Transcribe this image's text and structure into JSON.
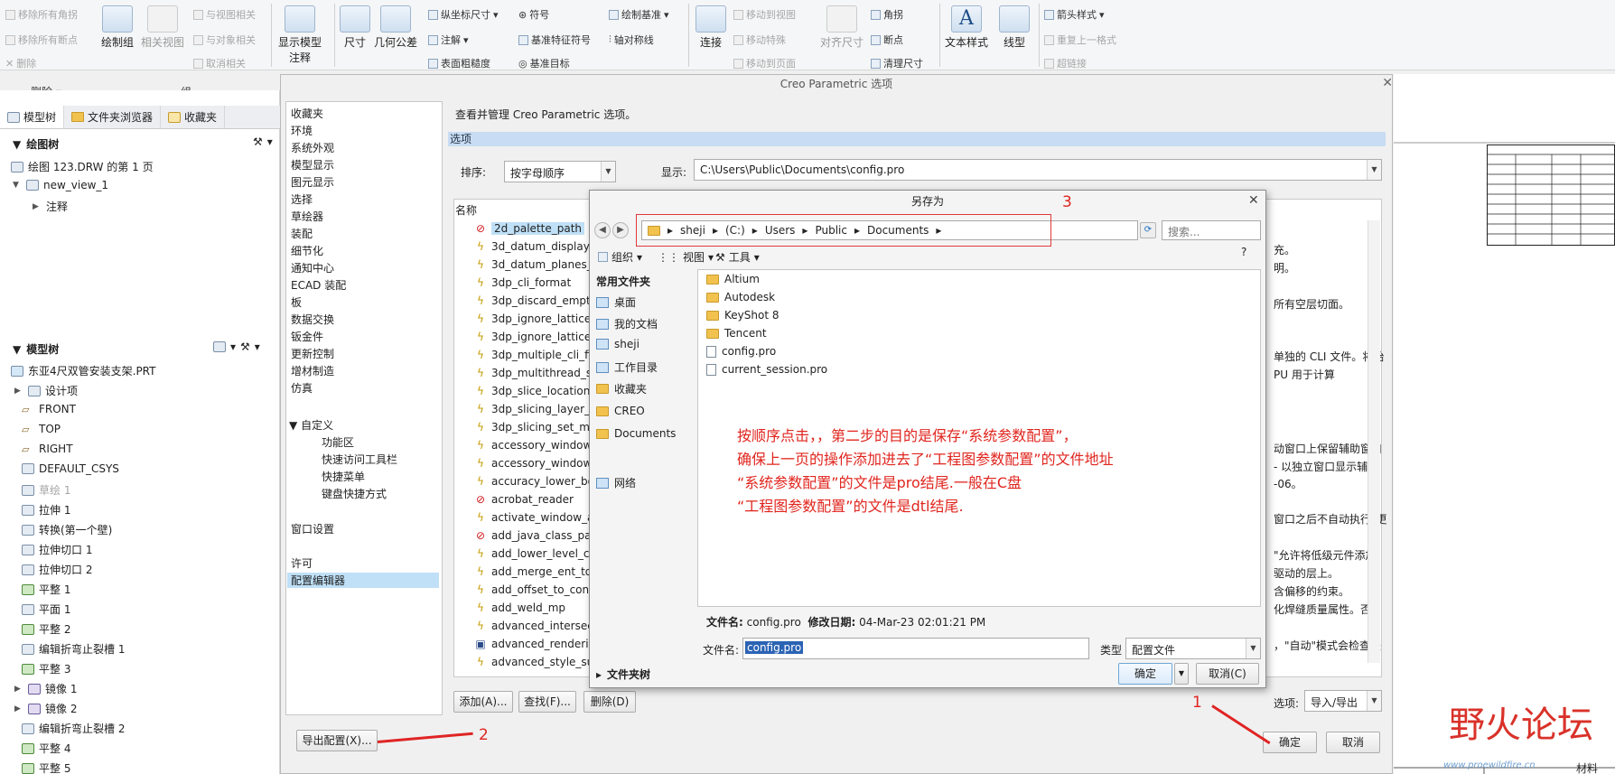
{
  "ribbon": {
    "remove_all_corners": "移除所有角拐",
    "remove_all_breaks": "移除所有断点",
    "delete": "删除",
    "delete_group": "删除",
    "drawing_group": "绘制组",
    "related_view": "相关视图",
    "group_label": "组",
    "with_view_related": "与视图相关",
    "with_object_related": "与对象相关",
    "cancel_related": "取消相关",
    "show_model_annotation": "显示模型",
    "show_model_annotation_2": "注释",
    "dimension": "尺寸",
    "geo_tol": "几何公差",
    "ordinate_dim": "纵坐标尺寸",
    "annotation": "注解",
    "surface_finish": "表面粗糙度",
    "symbol": "符号",
    "datum_feature_symbol": "基准特征符号",
    "datum_target": "基准目标",
    "draw_datum": "绘制基准",
    "axis_symmetry": "轴对称线",
    "connect": "连接",
    "move_to_view": "移动到视图",
    "move_special": "移动特殊",
    "move_to_page": "移动到页面",
    "align_dim": "对齐尺寸",
    "corner": "角拐",
    "break": "断点",
    "cleanup_dim": "清理尺寸",
    "text_style": "文本样式",
    "line_style": "线型",
    "arrow_style": "箭头样式",
    "repeat_format": "重复上一格式",
    "hyperlink": "超链接"
  },
  "left_panel": {
    "tabs": [
      "模型树",
      "文件夹浏览器",
      "收藏夹"
    ],
    "drawing_tree_title": "绘图树",
    "drawing_items": [
      "绘图 123.DRW 的第 1 页",
      "new_view_1",
      "注释"
    ],
    "model_tree_title": "模型树",
    "model_root": "东亚4尺双管安装支架.PRT",
    "model_items": [
      "设计项",
      "FRONT",
      "TOP",
      "RIGHT",
      "DEFAULT_CSYS",
      "草绘 1",
      "拉伸 1",
      "转换(第一个壁)",
      "拉伸切口 1",
      "拉伸切口 2",
      "平整 1",
      "平面 1",
      "平整 2",
      "编辑折弯止裂槽 1",
      "平整 3",
      "镜像 1",
      "镜像 2",
      "编辑折弯止裂槽 2",
      "平整 4",
      "平整 5"
    ]
  },
  "options_dialog": {
    "title": "Creo Parametric 选项",
    "categories": [
      "收藏夹",
      "环境",
      "系统外观",
      "模型显示",
      "图元显示",
      "选择",
      "草绘器",
      "装配",
      "细节化",
      "通知中心",
      "ECAD 装配",
      "板",
      "数据交换",
      "钣金件",
      "更新控制",
      "增材制造",
      "仿真"
    ],
    "custom": "自定义",
    "custom_sub": [
      "功能区",
      "快速访问工具栏",
      "快捷菜单",
      "键盘快捷方式"
    ],
    "window_settings": "窗口设置",
    "license": "许可",
    "config_editor": "配置编辑器",
    "description": "查看并管理 Creo Parametric 选项。",
    "section": "选项",
    "sort_label": "排序:",
    "sort_value": "按字母顺序",
    "display_label": "显示:",
    "display_value": "C:\\Users\\Public\\Documents\\config.pro",
    "col_name": "名称",
    "options": [
      {
        "name": "2d_palette_path",
        "icon": "no"
      },
      {
        "name": "3d_datum_display",
        "icon": "bolt"
      },
      {
        "name": "3d_datum_planes_",
        "icon": "bolt"
      },
      {
        "name": "3dp_cli_format",
        "icon": "bolt"
      },
      {
        "name": "3dp_discard_empt",
        "icon": "bolt"
      },
      {
        "name": "3dp_ignore_lattice",
        "icon": "bolt"
      },
      {
        "name": "3dp_ignore_lattice",
        "icon": "bolt"
      },
      {
        "name": "3dp_multiple_cli_fi",
        "icon": "bolt"
      },
      {
        "name": "3dp_multithread_s",
        "icon": "bolt"
      },
      {
        "name": "3dp_slice_location",
        "icon": "bolt"
      },
      {
        "name": "3dp_slicing_layer_",
        "icon": "bolt"
      },
      {
        "name": "3dp_slicing_set_m",
        "icon": "bolt"
      },
      {
        "name": "accessory_window",
        "icon": "bolt"
      },
      {
        "name": "accessory_window",
        "icon": "bolt"
      },
      {
        "name": "accuracy_lower_bo",
        "icon": "bolt"
      },
      {
        "name": "acrobat_reader",
        "icon": "no"
      },
      {
        "name": "activate_window_a",
        "icon": "bolt"
      },
      {
        "name": "add_java_class_pa",
        "icon": "no"
      },
      {
        "name": "add_lower_level_c",
        "icon": "bolt"
      },
      {
        "name": "add_merge_ent_to",
        "icon": "bolt"
      },
      {
        "name": "add_offset_to_con",
        "icon": "bolt"
      },
      {
        "name": "add_weld_mp",
        "icon": "bolt"
      },
      {
        "name": "advanced_intersec",
        "icon": "bolt"
      },
      {
        "name": "advanced_renderi",
        "icon": "box"
      },
      {
        "name": "advanced_style_su",
        "icon": "bolt"
      }
    ],
    "right_texts": [
      "充。",
      "明。",
      "所有空层切面。",
      "单独的 CLI 文件。将始",
      "PU 用于计算",
      "动窗口上保留辅助窗口",
      "- 以独立窗口显示辅助",
      "-06。",
      "窗口之后不自动执行\"更",
      "\"允许将低级元件添加",
      "驱动的层上。",
      "含偏移的约束。",
      "化焊缝质量属性。否 -",
      "，\"自动\"模式会检查是"
    ],
    "add_btn": "添加(A)...",
    "find_btn": "查找(F)...",
    "delete_btn": "删除(D)",
    "options_label": "选项:",
    "import_export": "导入/导出",
    "export_config": "导出配置(X)...",
    "ok": "确定",
    "cancel": "取消"
  },
  "save_as": {
    "title": "另存为",
    "path": [
      "sheji",
      "(C:)",
      "Users",
      "Public",
      "Documents"
    ],
    "search_placeholder": "搜索...",
    "organize": "组织",
    "view": "视图",
    "tools": "工具",
    "common_folders": "常用文件夹",
    "favorites": [
      "桌面",
      "我的文档",
      "sheji",
      "工作目录",
      "收藏夹",
      "CREO",
      "Documents"
    ],
    "network": "网络",
    "folder_tree": "文件夹树",
    "files": [
      {
        "name": "Altium",
        "type": "folder"
      },
      {
        "name": "Autodesk",
        "type": "folder"
      },
      {
        "name": "KeyShot 8",
        "type": "folder"
      },
      {
        "name": "Tencent",
        "type": "folder"
      },
      {
        "name": "config.pro",
        "type": "file"
      },
      {
        "name": "current_session.pro",
        "type": "file"
      }
    ],
    "meta_filename_label": "文件名:",
    "meta_filename": "config.pro",
    "meta_date_label": "修改日期:",
    "meta_date": "04-Mar-23 02:01:21 PM",
    "filename_label": "文件名:",
    "filename_value": "config.pro",
    "type_label": "类型",
    "type_value": "配置文件",
    "ok": "确定",
    "cancel": "取消(C)"
  },
  "annotation": {
    "line1": "按顺序点击，，第二步的目的是保存“系统参数配置”，",
    "line2": "确保上一页的操作添加进去了“工程图参数配置”的文件地址",
    "line3": "“系统参数配置”的文件是pro结尾.一般在C盘",
    "line4": "“工程图参数配置”的文件是dtl结尾.",
    "n1": "1",
    "n2": "2",
    "n3": "3"
  },
  "watermark": {
    "text": "野火论坛",
    "url": "www.proewildfire.cn",
    "material": "材料"
  },
  "colors": {
    "accent": "#2b63b4",
    "annotation_red": "#e0251e",
    "selection": "#bfe0f7"
  }
}
